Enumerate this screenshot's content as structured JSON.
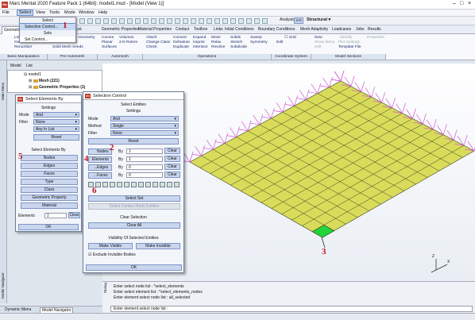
{
  "window": {
    "title": "Marc Mentat 2020 Feature Pack 1 (64bit): model1.mud - [Model (View 1)]"
  },
  "menubar": {
    "items": [
      "File",
      "Select",
      "View",
      "Tools",
      "Mode",
      "Window",
      "Help"
    ],
    "active": "Select"
  },
  "toolbar": {
    "analysis_label": "Analysis",
    "analysis_dim": "3-D",
    "analysis_type": "Structural"
  },
  "tabs": [
    "Geometry & Mesh",
    "Geom. & Mesh Syst.",
    "Geometric Properties",
    "Material Properties",
    "Contact",
    "Toolbox",
    "Links",
    "Initial Conditions",
    "Boundary Conditions",
    "Mesh Adaptivity",
    "Loadcases",
    "Jobs",
    "Results"
  ],
  "ribbon": {
    "groups": [
      {
        "name": "Basic Manipulation",
        "items": [
          "List",
          "Geometry",
          "Renumber"
        ]
      },
      {
        "name": "Pre-Automesh",
        "items": [
          "Repair Geometry",
          "Fill Solutions",
          "Solid Mesh Seeds"
        ]
      },
      {
        "name": "Automesh",
        "items": [
          "Curves",
          "Planar",
          "Surfaces",
          "Volumes",
          "2-D Rulers"
        ]
      },
      {
        "name": "",
        "items": [
          "Attach",
          "Change Class",
          "Check"
        ]
      },
      {
        "name": "Operations",
        "items": [
          "Convert",
          "Defeature",
          "Duplicate",
          "Expand",
          "Imprint",
          "Intersect",
          "Move",
          "Relax",
          "Revolve",
          "Solids",
          "Stretch",
          "Subdivide",
          "Sweep",
          "Symmetry"
        ]
      },
      {
        "name": "Coordinate System",
        "items": [
          "Grid",
          "Edit"
        ]
      },
      {
        "name": "Model Sections",
        "items": [
          "New",
          "Show Menu",
          "Edit",
          "Identify",
          "Plot Settings",
          "Properties",
          "Template File"
        ]
      }
    ]
  },
  "select_menu": {
    "header1": "Select",
    "item1": "Selection Control...",
    "header2": "Sets",
    "item2": "Set Control..."
  },
  "left_panel": {
    "vertical_labels": [
      "Main Menu",
      "Model Navigator"
    ],
    "tabs": [
      "Model",
      "List"
    ],
    "tree": [
      "model1",
      "Mesh (221)",
      "Geometric Properties (1)"
    ]
  },
  "select_elements_by": {
    "title": "Select Elements By",
    "settings": "Settings",
    "mode_label": "Mode",
    "mode_value": "And",
    "filter_label": "Filter",
    "filter_value": "None",
    "filter_sub": "Any In List",
    "reset": "Reset",
    "section": "Select Elements By",
    "buttons": [
      "Nodes",
      "Edges",
      "Faces",
      "Type",
      "Class",
      "Geometric Property",
      "Material"
    ],
    "elements_label": "Elements",
    "elements_value": "1",
    "clear": "Clear",
    "ok": "OK"
  },
  "selection_control": {
    "title": "Selection Control",
    "section_title": "Select Entities",
    "settings": "Settings",
    "mode_label": "Mode",
    "mode_value": "And",
    "method_label": "Method",
    "method_value": "Single",
    "filter_label": "Filter",
    "filter_value": "None",
    "reset": "Reset",
    "rows": [
      {
        "label": "Nodes",
        "by": "By",
        "value": "1",
        "clear": "Clear"
      },
      {
        "label": "Elements",
        "by": "By",
        "value": "1",
        "clear": "Clear"
      },
      {
        "label": "...Edges",
        "by": "By",
        "value": "0",
        "clear": "Clear"
      },
      {
        "label": "...Faces",
        "by": "By",
        "value": "0",
        "clear": "Clear"
      }
    ],
    "select_set": "Select Set",
    "select_contact_body": "Select Contact Body Entities",
    "clear_selection_label": "Clear Selection",
    "clear_all": "Clear All",
    "visibility_title": "Visibility Of Selected Entities",
    "make_visible": "Make Visible",
    "make_invisible": "Make Invisible",
    "exclude_invisible": "Exclude Invisible Bodies",
    "ok": "OK"
  },
  "annotations": [
    "1",
    "2",
    "3",
    "4",
    "5",
    "6"
  ],
  "command_log": [
    "Enter select node list : *select_elements",
    "Enter select element list : *select_elements_nodes",
    "Enter element select node list : all_selected"
  ],
  "command_input": "Enter element select node list :",
  "dialog_vertical_label": "Dialog",
  "bottom_tabs": [
    "Dynamic Menu",
    "Model Navigator"
  ],
  "axis_labels": [
    "Z",
    "X"
  ],
  "colors": {
    "mesh_fill": "#d9dc5a",
    "mesh_line": "#3b3f1f",
    "selected_element": "#21d63b",
    "boundary_arrow": "#d458d4",
    "annotation": "#c0141a"
  }
}
